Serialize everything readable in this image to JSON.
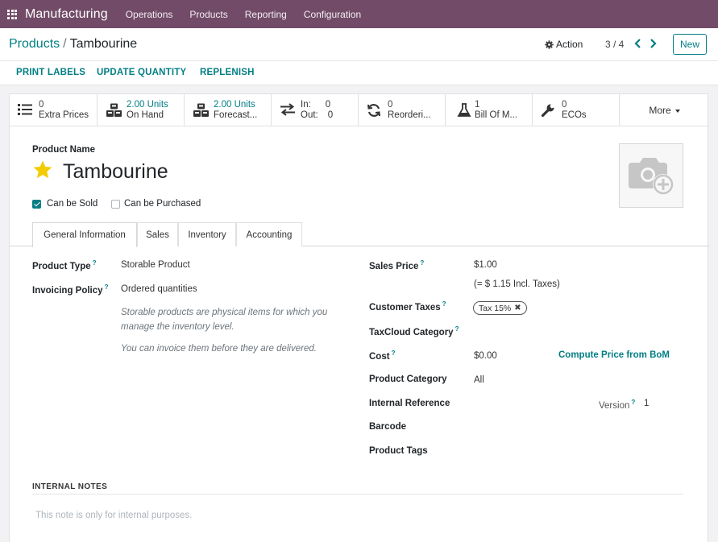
{
  "navbar": {
    "brand": "Manufacturing",
    "menu": [
      "Operations",
      "Products",
      "Reporting",
      "Configuration"
    ]
  },
  "breadcrumb": {
    "parent": "Products",
    "separator": "/",
    "current": "Tambourine"
  },
  "control": {
    "action_label": "Action",
    "pager": "3 / 4",
    "new_label": "New"
  },
  "status_buttons": [
    "PRINT LABELS",
    "UPDATE QUANTITY",
    "REPLENISH"
  ],
  "smart_buttons": [
    {
      "icon": "list-icon",
      "value": "0",
      "label": "Extra Prices"
    },
    {
      "icon": "cubes-icon",
      "value": "2.00 Units",
      "label": "On Hand"
    },
    {
      "icon": "cubes-icon",
      "value": "2.00 Units",
      "label": "Forecast..."
    },
    {
      "icon": "transfer-arrows-icon",
      "in_label": "In:",
      "in_value": "0",
      "out_label": "Out:",
      "out_value": "0"
    },
    {
      "icon": "refresh-icon",
      "value": "0",
      "label": "Reorderi..."
    },
    {
      "icon": "flask-icon",
      "value": "1",
      "label": "Bill Of M..."
    },
    {
      "icon": "wrench-icon",
      "value": "0",
      "label": "ECOs"
    }
  ],
  "more_label": "More",
  "product": {
    "name_label": "Product Name",
    "name": "Tambourine",
    "can_be_sold": "Can be Sold",
    "can_be_purchased": "Can be Purchased"
  },
  "tabs": [
    "General Information",
    "Sales",
    "Inventory",
    "Accounting"
  ],
  "general": {
    "product_type_label": "Product Type",
    "product_type": "Storable Product",
    "invoicing_policy_label": "Invoicing Policy",
    "invoicing_policy": "Ordered quantities",
    "hint1": "Storable products are physical items for which you manage the inventory level.",
    "hint2": "You can invoice them before they are delivered.",
    "sales_price_label": "Sales Price",
    "sales_price": "$1.00",
    "incl_taxes": "(= $ 1.15 Incl. Taxes)",
    "customer_taxes_label": "Customer Taxes",
    "tax_tag": "Tax 15%",
    "taxcloud_label": "TaxCloud Category",
    "cost_label": "Cost",
    "cost": "$0.00",
    "compute_bom": "Compute Price from BoM",
    "category_label": "Product Category",
    "category": "All",
    "internal_ref_label": "Internal Reference",
    "version_label": "Version",
    "version": "1",
    "barcode_label": "Barcode",
    "tags_label": "Product Tags"
  },
  "notes": {
    "title": "INTERNAL NOTES",
    "placeholder": "This note is only for internal purposes."
  },
  "colors": {
    "brand": "#714b67",
    "accent": "#017e84",
    "star": "#f3cc00"
  }
}
